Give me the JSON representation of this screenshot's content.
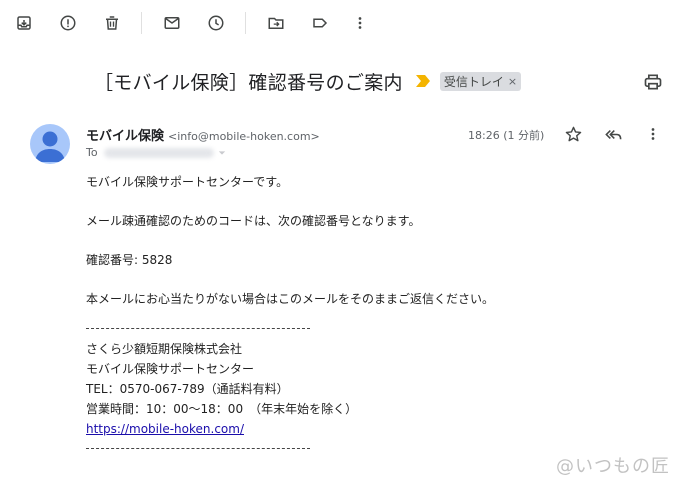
{
  "toolbar": {
    "buttons": [
      {
        "name": "archive-icon"
      },
      {
        "name": "report-spam-icon"
      },
      {
        "name": "delete-icon"
      },
      {
        "name": "mark-unread-icon"
      },
      {
        "name": "snooze-icon"
      },
      {
        "name": "move-to-icon"
      },
      {
        "name": "label-icon"
      },
      {
        "name": "more-vert-icon"
      }
    ]
  },
  "message": {
    "subject": "［モバイル保険］確認番号のご案内",
    "label": "受信トレイ",
    "label_remove": "×",
    "sender_name": "モバイル保険",
    "sender_email": "<info@mobile-hoken.com>",
    "to_prefix": "To",
    "timestamp": "18:26 (1 分前)"
  },
  "body": {
    "line1": "モバイル保険サポートセンターです。",
    "line2": "メール疎通確認のためのコードは、次の確認番号となります。",
    "line3": "確認番号: 5828",
    "line4": "本メールにお心当たりがない場合はこのメールをそのままご返信ください。",
    "sig1": "さくら少額短期保険株式会社",
    "sig2": "モバイル保険サポートセンター",
    "sig3": "TEL：0570-067-789（通話料有料）",
    "sig4": "営業時間：10：00～18：00　（年末年始を除く）",
    "link": "https://mobile-hoken.com/"
  },
  "watermark": "@いつもの匠",
  "colors": {
    "avatar": "#a8c7fa",
    "avatar_figure": "#3b6fd4",
    "importance": "#f4b400",
    "link": "#1a0dab"
  }
}
